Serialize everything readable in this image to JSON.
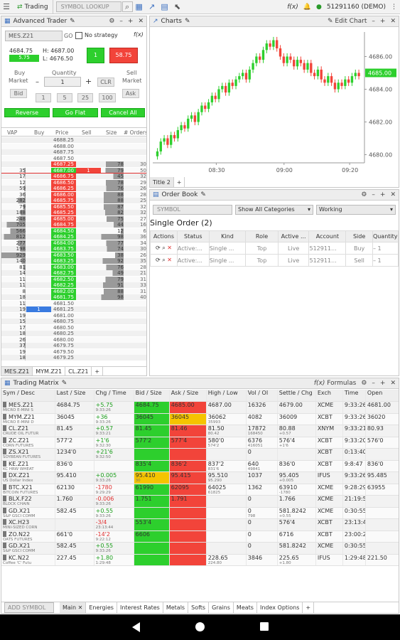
{
  "topbar": {
    "tab": "Trading",
    "search_placeholder": "SYMBOL LOOKUP",
    "account": "51291160 (DEMO)",
    "fx_label": "f(x)"
  },
  "trader": {
    "title": "Advanced Trader",
    "symbol": "MES.Z21",
    "go": "GO",
    "strategy": "No strategy",
    "last": "4684.75",
    "chg": "5.75",
    "high_label": "H:",
    "high": "4687.00",
    "low_label": "L:",
    "low": "4676.50",
    "buy_qty": "1",
    "sell_price": "58.75",
    "buy_label": "Buy",
    "sell_label": "Sell",
    "qty_label": "Quantity",
    "market_buy": "Market",
    "market_sell": "Market",
    "bid": "Bid",
    "ask": "Ask",
    "clr": "CLR",
    "qty_value": "1",
    "q1": "1",
    "q5": "5",
    "q25": "25",
    "q100": "100",
    "reverse": "Reverse",
    "goflat": "Go Flat",
    "cancelall": "Cancel All",
    "cols": [
      "VAP",
      "Buy",
      "Price",
      "Sell",
      "Size",
      "# Orders"
    ],
    "tabs": [
      "MES.Z21",
      "MYM.Z21",
      "CL.Z21"
    ]
  },
  "ladder": [
    {
      "p": "4688.25"
    },
    {
      "p": "4688.00"
    },
    {
      "p": "4687.75"
    },
    {
      "p": "4687.50"
    },
    {
      "p": "4687.25",
      "sell": true,
      "size": "78",
      "ord": "30"
    },
    {
      "p": "4687.00",
      "sell": true,
      "hl": true,
      "sz": "1",
      "size": "79",
      "ord": "50",
      "vap": "35"
    },
    {
      "p": "4686.75",
      "sell": true,
      "size": "45",
      "ord": "32",
      "vap": "17"
    },
    {
      "p": "4686.50",
      "sell": true,
      "size": "78",
      "ord": "29",
      "vap": "12"
    },
    {
      "p": "4686.25",
      "sell": true,
      "size": "76",
      "ord": "26",
      "vap": "59"
    },
    {
      "p": "4686.00",
      "sell": true,
      "size": "88",
      "ord": "28",
      "vap": "36"
    },
    {
      "p": "4685.75",
      "sell": true,
      "size": "88",
      "ord": "25",
      "vap": "282"
    },
    {
      "p": "4685.50",
      "sell": true,
      "size": "87",
      "ord": "32",
      "vap": "79"
    },
    {
      "p": "4685.25",
      "sell": true,
      "size": "82",
      "ord": "32",
      "vap": "188"
    },
    {
      "p": "4685.00",
      "sell": true,
      "size": "75",
      "ord": "27",
      "vap": "248"
    },
    {
      "p": "4684.75",
      "sell": true,
      "size": "44",
      "ord": "16",
      "vap": "705"
    },
    {
      "p": "4684.50",
      "buy": true,
      "size": "12",
      "ord": "6",
      "vap": "566"
    },
    {
      "p": "4684.25",
      "buy": true,
      "size": "98",
      "ord": "36",
      "vap": "812"
    },
    {
      "p": "4684.00",
      "buy": true,
      "size": "77",
      "ord": "34",
      "vap": "277"
    },
    {
      "p": "4683.75",
      "buy": true,
      "size": "74",
      "ord": "30",
      "vap": "198"
    },
    {
      "p": "4683.50",
      "buy": true,
      "size": "38",
      "ord": "26",
      "vap": "929"
    },
    {
      "p": "4683.25",
      "buy": true,
      "size": "92",
      "ord": "35",
      "vap": "140"
    },
    {
      "p": "4683.00",
      "buy": true,
      "size": "76",
      "ord": "28",
      "vap": "81"
    },
    {
      "p": "4682.75",
      "buy": true,
      "size": "49",
      "ord": "21",
      "vap": "14"
    },
    {
      "p": "4682.50",
      "buy": true,
      "size": "79",
      "ord": "31",
      "vap": "11"
    },
    {
      "p": "4682.25",
      "buy": true,
      "size": "91",
      "ord": "33",
      "vap": "11"
    },
    {
      "p": "4682.00",
      "buy": true,
      "size": "88",
      "ord": "31",
      "vap": "8"
    },
    {
      "p": "4681.75",
      "buy": true,
      "size": "98",
      "ord": "40",
      "vap": "18"
    },
    {
      "p": "4681.50",
      "vap": "11"
    },
    {
      "p": "4681.25",
      "vap": "19",
      "bsz": "1"
    },
    {
      "p": "4681.00",
      "vap": "19"
    },
    {
      "p": "4680.75",
      "vap": "15"
    },
    {
      "p": "4680.50",
      "vap": "17"
    },
    {
      "p": "4680.25",
      "vap": "18"
    },
    {
      "p": "4680.00",
      "vap": "26"
    },
    {
      "p": "4679.75",
      "vap": "37"
    },
    {
      "p": "4679.50",
      "vap": "19"
    },
    {
      "p": "4679.25",
      "vap": "18"
    }
  ],
  "chart": {
    "title": "Charts",
    "edit": "Edit Chart",
    "tab": "Title 2",
    "price_tag": "4685.00",
    "yticks": [
      "4686.00",
      "4684.00",
      "4682.00",
      "4680.00"
    ],
    "xticks": [
      "08:30",
      "09:00",
      "09:20"
    ],
    "chart_data": {
      "type": "candlestick",
      "x": [
        "08:20",
        "09:25"
      ],
      "y_range": [
        4679.5,
        4687.5
      ],
      "ylabels": [
        4686,
        4684,
        4682,
        4680
      ],
      "closes": [
        4680.2,
        4680.8,
        4681.0,
        4680.6,
        4681.2,
        4681.0,
        4681.5,
        4681.8,
        4681.6,
        4682.2,
        4682.4,
        4682.0,
        4682.6,
        4683.0,
        4682.8,
        4683.2,
        4683.6,
        4683.4,
        4684.0,
        4684.2,
        4683.8,
        4684.4,
        4684.2,
        4684.6,
        4684.8,
        4685.0,
        4684.6,
        4685.2,
        4685.6,
        4686.0,
        4685.8,
        4686.4,
        4686.8,
        4686.6,
        4687.0,
        4686.5,
        4686.0,
        4685.6,
        4686.0,
        4685.8,
        4685.4,
        4685.8,
        4685.6,
        4685.2,
        4685.6,
        4685.0,
        4684.8,
        4685.2,
        4684.6,
        4684.4,
        4684.8,
        4684.4,
        4684.0,
        4684.4,
        4684.2,
        4684.6,
        4684.4,
        4684.8,
        4685.0,
        4684.8
      ],
      "last": 4685.0
    }
  },
  "orderbook": {
    "title": "Order Book",
    "symbol_ph": "SYMBOL",
    "filter": "Show All Categories",
    "status": "Working",
    "heading": "Single Order (2)",
    "cols": [
      "Actions",
      "Status",
      "Kind",
      "Role",
      "Active ...",
      "Account",
      "Side",
      "Quantity"
    ],
    "rows": [
      {
        "status": "Active:...",
        "kind": "Single ...",
        "role": "Top",
        "active": "Live",
        "account": "512911...",
        "side": "Buy",
        "qty": "1"
      },
      {
        "status": "Active:...",
        "kind": "Single ...",
        "role": "Top",
        "active": "Live",
        "account": "512911...",
        "side": "Sell",
        "qty": "1"
      }
    ]
  },
  "matrix": {
    "title": "Trading Matrix",
    "formulas": "Formulas",
    "add": "ADD SYMBOL",
    "tabs": [
      "Main",
      "Energies",
      "Interest Rates",
      "Metals",
      "Softs",
      "Grains",
      "Meats",
      "Index Options"
    ],
    "cols": [
      "Sym / Desc",
      "Last / Size",
      "Chg / Time",
      "Bid / Size",
      "Ask / Size",
      "High / Low",
      "Vol / OI",
      "Settle / Chg",
      "Exch",
      "Time",
      "Open"
    ],
    "rows": [
      {
        "sym": "MES.Z21",
        "desc": "MICRO E-MINI S",
        "last": "4684.75",
        "lsz": "",
        "chg": "+5.75",
        "tm": "9:33:26",
        "bid": "4684.75",
        "bsz": "",
        "ask": "4685.00",
        "asz": "",
        "hi": "4687.00",
        "lo": "",
        "vol": "16326",
        "oi": "",
        "set": "4679.00",
        "sc": "",
        "exch": "XCME",
        "time": "9:33:26",
        "open": "4681.00",
        "bidg": true,
        "askr": true,
        "dir": "up"
      },
      {
        "sym": "MYM.Z21",
        "desc": "MICRO E-MINI D",
        "last": "36045",
        "lsz": "",
        "chg": "+36",
        "tm": "9:33:26",
        "bid": "36045",
        "bsz": "",
        "ask": "36045",
        "asz": "",
        "hi": "36062",
        "lo": "35993",
        "vol": "4082",
        "oi": "",
        "set": "36009",
        "sc": "",
        "exch": "XCBT",
        "time": "9:33:26",
        "open": "36020",
        "bidg": true,
        "askr": true,
        "asky": true,
        "dir": "up"
      },
      {
        "sym": "CL.Z21",
        "desc": "CRUDE OIL FUTUR",
        "last": "81.45",
        "lsz": "",
        "chg": "+0.57",
        "tm": "9:33:21",
        "bid": "81.45",
        "bsz": "",
        "ask": "81.46",
        "asz": "",
        "hi": "81.50",
        "lo": "80.42",
        "vol": "17872",
        "oi": "168450",
        "set": "80.88",
        "sc": "+0.57",
        "exch": "XNYM",
        "time": "9:33:21",
        "open": "80.93",
        "bidg": true,
        "askr": true,
        "dir": "up"
      },
      {
        "sym": "ZC.Z21",
        "desc": "CORN FUTURES",
        "last": "577'2",
        "lsz": "",
        "chg": "+1'6",
        "tm": "9:32:30",
        "bid": "577'2",
        "bsz": "",
        "ask": "577'4",
        "asz": "",
        "hi": "580'0",
        "lo": "574'2",
        "vol": "6376",
        "oi": "416051",
        "set": "576'4",
        "sc": "+1'6",
        "exch": "XCBT",
        "time": "9:33:20",
        "open": "576'0",
        "bidg": true,
        "askr": true,
        "dir": "up"
      },
      {
        "sym": "ZS.X21",
        "desc": "SOYBEAN FUTURES",
        "last": "1234'0",
        "lsz": "",
        "chg": "+21'6",
        "tm": "9:32:50",
        "bid": "",
        "bsz": "",
        "ask": "",
        "asz": "",
        "hi": "",
        "lo": "",
        "vol": "0",
        "oi": "",
        "set": "",
        "sc": "",
        "exch": "XCBT",
        "time": "0:13:40",
        "open": "",
        "bidg": true,
        "askr": true,
        "dir": "up"
      },
      {
        "sym": "KE.Z21",
        "desc": "KC HRW WHEAT",
        "last": "836'0",
        "lsz": "",
        "chg": "",
        "tm": "",
        "bid": "835'4",
        "bsz": "",
        "ask": "836'2",
        "asz": "",
        "hi": "837'2",
        "lo": "831'6",
        "vol": "640",
        "oi": "49841",
        "set": "836'0",
        "sc": "",
        "exch": "XCBT",
        "time": "9:8:47",
        "open": "836'0",
        "bidg": true,
        "askr": true,
        "dir": "up"
      },
      {
        "sym": "DX.Z21",
        "desc": "US Dollar Index",
        "last": "95.410",
        "lsz": "",
        "chg": "+0.005",
        "tm": "9:33:26",
        "bid": "95.410",
        "bsz": "30",
        "ask": "95.415",
        "asz": "",
        "hi": "95.510",
        "lo": "95.290",
        "vol": "1037",
        "oi": "",
        "set": "95.405",
        "sc": "+0.005",
        "exch": "IFUS",
        "time": "9:33:26",
        "open": "95.485",
        "bidg": true,
        "askr": true,
        "bidy": true,
        "dir": "up"
      },
      {
        "sym": "BTC.X21",
        "desc": "BITCOIN FUTURES",
        "last": "62130",
        "lsz": "",
        "chg": "-1780",
        "tm": "9:29:29",
        "bid": "61990",
        "bsz": "",
        "ask": "62095",
        "asz": "",
        "hi": "64025",
        "lo": "61825",
        "vol": "1362",
        "oi": "",
        "set": "63910",
        "sc": "-1780",
        "exch": "XCME",
        "time": "9:28:29",
        "open": "63955",
        "bidg": true,
        "askr": true,
        "dir": "dn"
      },
      {
        "sym": "BLX.F22",
        "desc": "BLOCK CHAIN",
        "last": "1.760",
        "lsz": "",
        "chg": "-0.006",
        "tm": "9:33:26",
        "bid": "1.751",
        "bsz": "",
        "ask": "1.791",
        "asz": "",
        "hi": "",
        "lo": "",
        "vol": "0",
        "oi": "",
        "set": "1.766",
        "sc": "",
        "exch": "XCME",
        "time": "21:19:5",
        "open": "",
        "bidg": true,
        "askr": true,
        "dir": "dn"
      },
      {
        "sym": "GD.X21",
        "desc": "S&P GSCI COMM",
        "last": "582.45",
        "lsz": "",
        "chg": "+0.55",
        "tm": "9:33:26",
        "bid": "",
        "bsz": "",
        "ask": "",
        "asz": "",
        "hi": "",
        "lo": "",
        "vol": "0",
        "oi": "798",
        "set": "581.8242",
        "sc": "+0.55",
        "exch": "XCME",
        "time": "0:30:55",
        "open": "",
        "bidg": true,
        "askr": true,
        "dir": "up"
      },
      {
        "sym": "XC.H23",
        "desc": "MINI-SIZED CORN",
        "last": "",
        "lsz": "",
        "chg": "-3/4",
        "tm": "23:13:44",
        "bid": "553'4",
        "bsz": "",
        "ask": "",
        "asz": "",
        "hi": "",
        "lo": "",
        "vol": "0",
        "oi": "",
        "set": "576'4",
        "sc": "",
        "exch": "XCBT",
        "time": "23:13:44",
        "open": "",
        "bidg": true,
        "askr": true,
        "dir": "dn"
      },
      {
        "sym": "ZO.N22",
        "desc": "OATS FUTURES",
        "last": "661'0",
        "lsz": "",
        "chg": "-14'2",
        "tm": "9:22:12",
        "bid": "6606",
        "bsz": "",
        "ask": "",
        "asz": "",
        "hi": "",
        "lo": "",
        "vol": "0",
        "oi": "",
        "set": "6716",
        "sc": "",
        "exch": "XCBT",
        "time": "23:00:24",
        "open": "",
        "bidg": true,
        "askr": true,
        "dir": "dn"
      },
      {
        "sym": "GD.X21",
        "desc": "S&P GSCI COMM",
        "last": "582.45",
        "lsz": "",
        "chg": "+0.55",
        "tm": "9:33:26",
        "bid": "",
        "bsz": "",
        "ask": "",
        "asz": "",
        "hi": "",
        "lo": "",
        "vol": "0",
        "oi": "",
        "set": "581.8242",
        "sc": "",
        "exch": "XCME",
        "time": "0:30:55",
        "open": "",
        "bidg": true,
        "askr": true,
        "dir": "up"
      },
      {
        "sym": "KC.N22",
        "desc": "Coffee 'C' Futu",
        "last": "227.45",
        "lsz": "",
        "chg": "+1.80",
        "tm": "1:29:48",
        "bid": "",
        "bsz": "",
        "ask": "",
        "asz": "",
        "hi": "228.65",
        "lo": "224.80",
        "vol": "3846",
        "oi": "",
        "set": "225.65",
        "sc": "+1.80",
        "exch": "IFUS",
        "time": "1:29:48",
        "open": "221.50",
        "bidg": true,
        "askr": true,
        "dir": "up"
      }
    ]
  },
  "colors": {
    "green": "#2dcf2d",
    "red": "#f2443a",
    "yellow": "#f5c400"
  }
}
